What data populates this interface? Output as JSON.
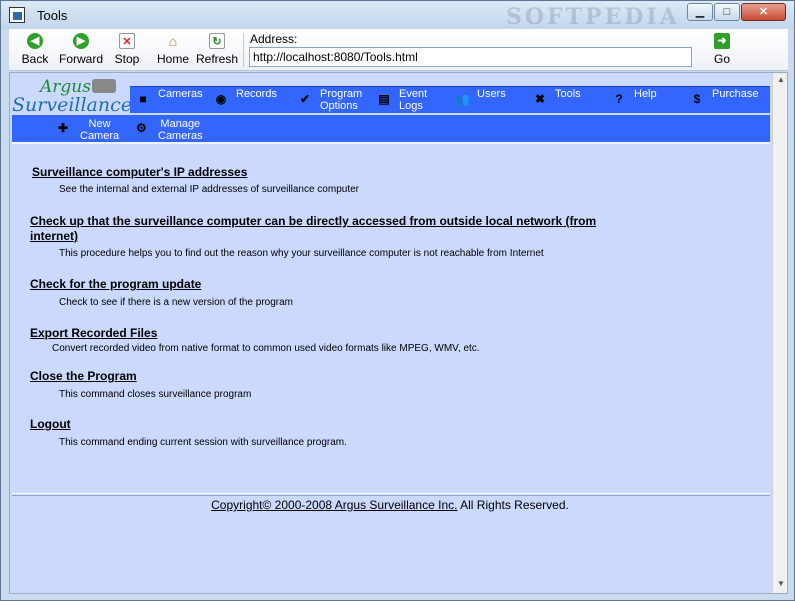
{
  "window": {
    "title": "Tools",
    "watermark": "SOFTPEDIA",
    "min_glyph": "▁",
    "max_glyph": "□",
    "close_glyph": "✕"
  },
  "toolbar": {
    "back_label": "Back",
    "forward_label": "Forward",
    "stop_label": "Stop",
    "home_label": "Home",
    "refresh_label": "Refresh",
    "address_label": "Address:",
    "address_value": "http://localhost:8080/Tools.html",
    "go_label": "Go"
  },
  "logo": {
    "line1": "Argus",
    "line2": "Surveillance"
  },
  "nav": {
    "items": [
      {
        "label": "Cameras",
        "icon": "camera-icon"
      },
      {
        "label": "Records",
        "icon": "disc-icon"
      },
      {
        "label": "Program\nOptions",
        "icon": "check-icon"
      },
      {
        "label": "Event\nLogs",
        "icon": "log-icon"
      },
      {
        "label": "Users",
        "icon": "users-icon"
      },
      {
        "label": "Tools",
        "icon": "tools-icon"
      },
      {
        "label": "Help",
        "icon": "help-icon"
      },
      {
        "label": "Purchase",
        "icon": "dollar-icon"
      }
    ],
    "sub_items": [
      {
        "label": "New\nCamera",
        "icon": "add-camera-icon"
      },
      {
        "label": "Manage\nCameras",
        "icon": "manage-cameras-icon"
      }
    ]
  },
  "tools": [
    {
      "title": "Surveillance computer's IP addresses",
      "desc": "See the internal and external IP addresses of surveillance computer"
    },
    {
      "title": "Check up that the surveillance computer can be directly accessed from outside local network (from internet)",
      "desc": "This procedure helps you to find out the reason why your surveillance computer is not reachable from Internet"
    },
    {
      "title": "Check for the program update",
      "desc": "Check to see if there is a new version of the program"
    },
    {
      "title": "Export Recorded Files",
      "desc": "Convert recorded video from native format to common used video formats like MPEG, WMV, etc."
    },
    {
      "title": "Close the Program",
      "desc": "This command closes surveillance program"
    },
    {
      "title": "Logout",
      "desc": "This command ending current session with surveillance program."
    }
  ],
  "footer": {
    "link": "Copyright© 2000-2008 Argus Surveillance Inc.",
    "rest": " All Rights Reserved."
  }
}
